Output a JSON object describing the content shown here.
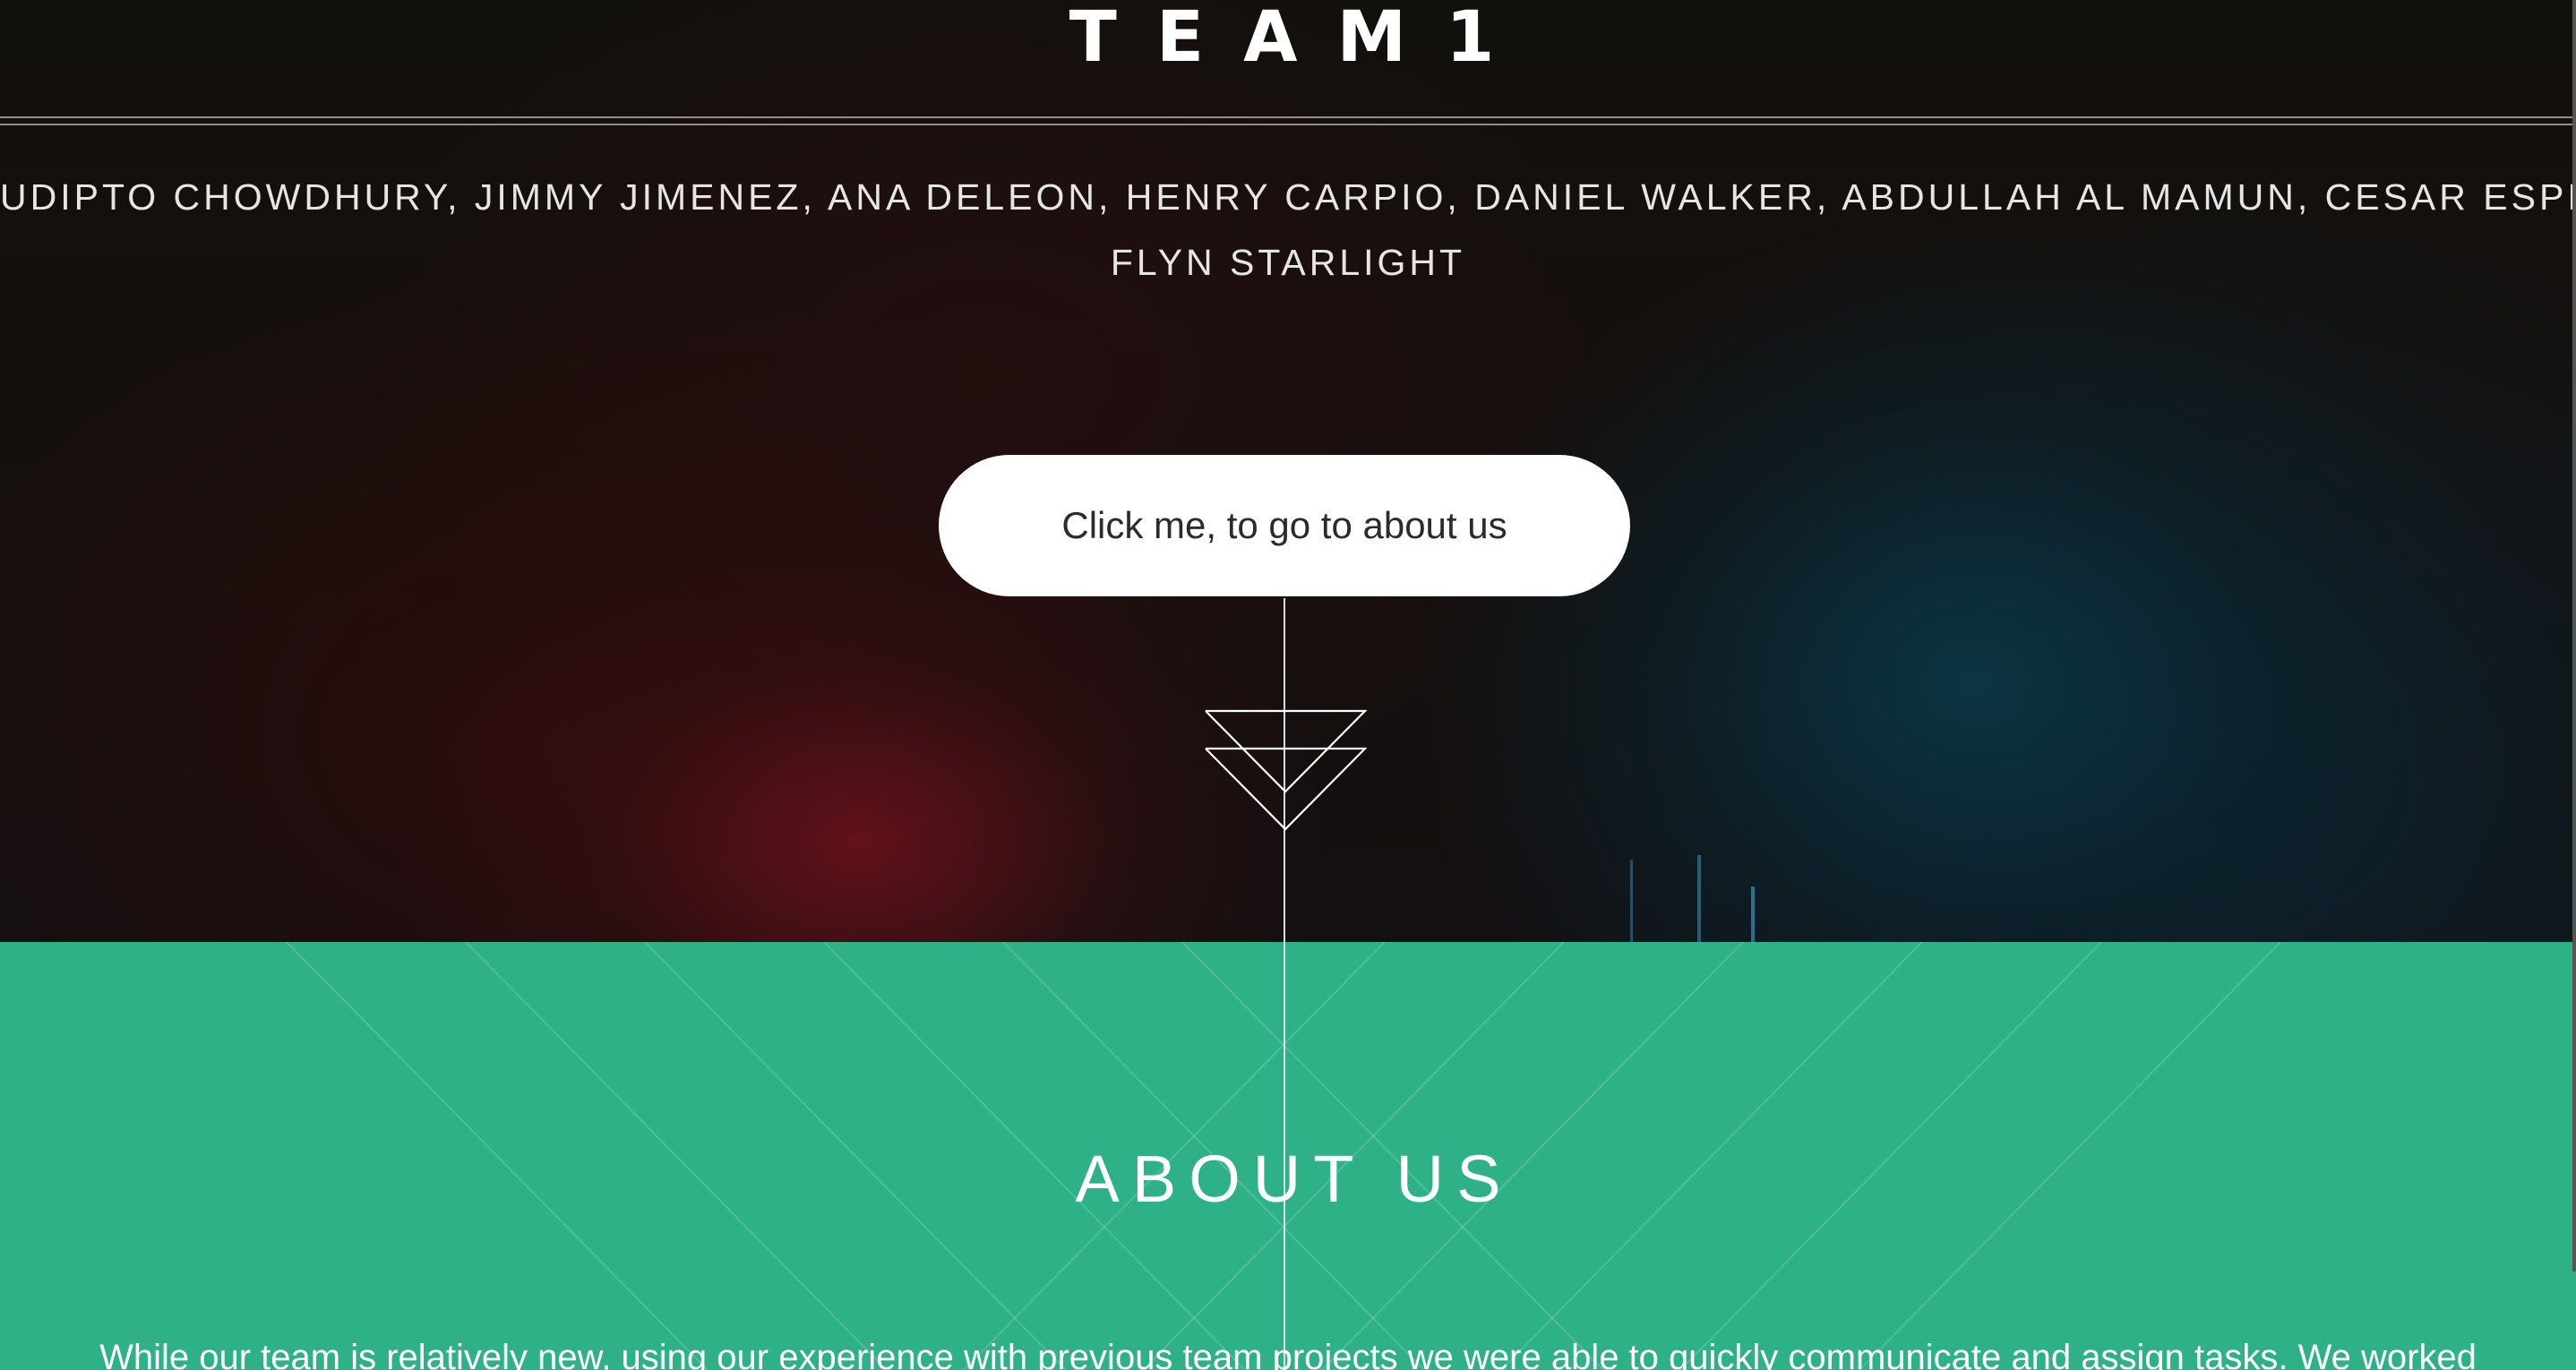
{
  "hero": {
    "title": "TEAM1",
    "members_line1": "UDIPTO CHOWDHURY, JIMMY JIMENEZ, ANA DELEON, HENRY CARPIO, DANIEL WALKER, ABDULLAH AL MAMUN, CESAR ESPINOZA,",
    "members_line2": "FLYN STARLIGHT",
    "cta_label": "Click me, to go to about us",
    "arrow_icon": "double-chevron-down-icon"
  },
  "about": {
    "title": "ABOUT US",
    "text": "While our team is relatively new, using our experience with previous team projects we were able to quickly communicate and assign tasks. We worked"
  },
  "colors": {
    "hero_background": "#12100c",
    "about_background": "#2eb186",
    "text": "#ffffff",
    "button_background": "#ffffff",
    "button_text": "#2b2b2b"
  }
}
